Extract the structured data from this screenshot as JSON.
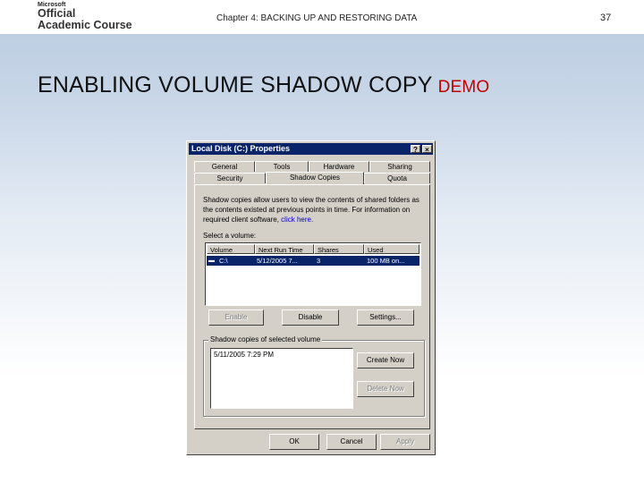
{
  "header": {
    "logo": {
      "ms": "Microsoft",
      "line1": "Official",
      "line2": "Academic Course"
    },
    "chapter": "Chapter 4: BACKING UP AND RESTORING DATA",
    "page": "37"
  },
  "slide": {
    "title": "ENABLING VOLUME SHADOW COPY",
    "tag": "DEMO"
  },
  "dialog": {
    "title": "Local Disk (C:) Properties",
    "help_btn": "?",
    "close_btn": "×",
    "tabs_row1": [
      "General",
      "Tools",
      "Hardware",
      "Sharing"
    ],
    "tabs_row2": [
      "Security",
      "Shadow Copies",
      "Quota"
    ],
    "active_tab": "Shadow Copies",
    "description": "Shadow copies allow users to view the contents of shared folders as the contents existed at previous points in time. For information on required client software,",
    "link": "click here.",
    "select_label": "Select a volume:",
    "columns": [
      "Volume",
      "Next Run Time",
      "Shares",
      "Used"
    ],
    "rows": [
      {
        "volume": "C:\\",
        "next_run": "5/12/2005 7...",
        "shares": "3",
        "used": "100 MB on..."
      }
    ],
    "enable_btn": "Enable",
    "disable_btn": "Disable",
    "settings_btn": "Settings...",
    "group_label": "Shadow copies of selected volume",
    "copies": [
      "5/11/2005 7:29 PM"
    ],
    "create_btn": "Create Now",
    "delete_btn": "Delete Now",
    "ok_btn": "OK",
    "cancel_btn": "Cancel",
    "apply_btn": "Apply"
  },
  "colors": {
    "titlebar": "#0a246a",
    "face": "#d4d0c8",
    "demo": "#c00000",
    "link": "#0000cc"
  }
}
